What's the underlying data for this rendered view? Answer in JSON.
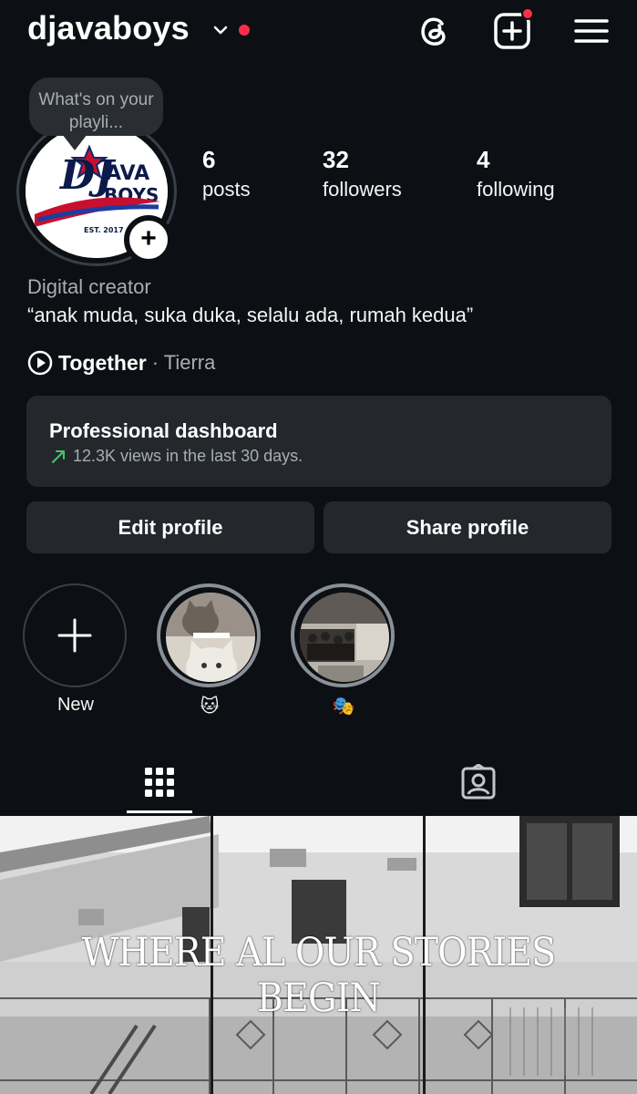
{
  "header": {
    "username": "djavaboys",
    "icons": [
      "chevron-down-icon",
      "threads-icon",
      "new-post-icon",
      "hamburger-menu-icon"
    ]
  },
  "profile": {
    "note": "What's on your playli...",
    "avatar_text": {
      "brand": "DJAVA BOYS",
      "est": "EST. 2017"
    },
    "stats": [
      {
        "num": "6",
        "label": "posts"
      },
      {
        "num": "32",
        "label": "followers"
      },
      {
        "num": "4",
        "label": "following"
      }
    ],
    "category": "Digital creator",
    "bio": "“anak muda, suka duka, selalu ada, rumah kedua”",
    "music": {
      "song": "Together",
      "artist": "· Tierra"
    }
  },
  "dashboard": {
    "title": "Professional dashboard",
    "subtitle": "12.3K views in the last 30 days."
  },
  "buttons": {
    "edit": "Edit profile",
    "share": "Share profile"
  },
  "highlights": [
    {
      "label": "New"
    },
    {
      "label": "🐱"
    },
    {
      "label": "🎭"
    }
  ],
  "tabs": [
    "grid-icon",
    "tagged-icon"
  ],
  "posts": {
    "banner_text": "WHERE AL OUR STORIES BEGIN"
  },
  "colors": {
    "background": "#0c1014",
    "card": "#24282d",
    "notification": "#ff2d4a",
    "trend": "#3ec76b"
  }
}
